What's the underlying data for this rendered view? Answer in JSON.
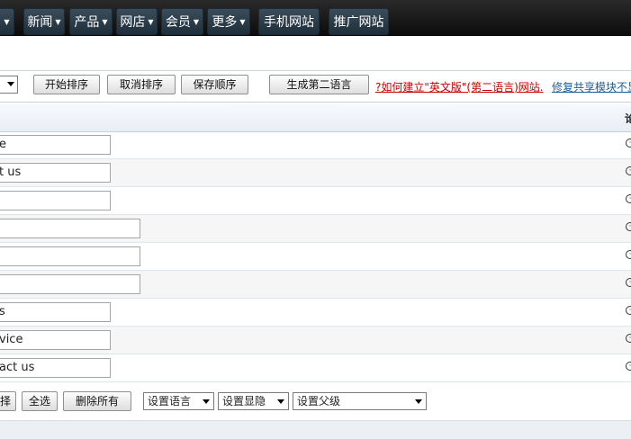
{
  "nav": {
    "items": [
      {
        "label": "新闻",
        "caret": true
      },
      {
        "label": "产品",
        "caret": true
      },
      {
        "label": "网店",
        "caret": true
      },
      {
        "label": "会员",
        "caret": true
      },
      {
        "label": "更多",
        "caret": true
      },
      {
        "label": "手机网站",
        "caret": false
      },
      {
        "label": "推广网站",
        "caret": false
      }
    ],
    "caret_glyph": "▼"
  },
  "toolbar": {
    "start_sort": "开始排序",
    "cancel_sort": "取消排序",
    "save_order": "保存顺序",
    "gen_second_lang": "生成第二语言",
    "help_link": "?如何建立\"英文版\"(第二语言)网站.",
    "repair_link": "修复共享模块不显"
  },
  "table": {
    "header_col": "论",
    "rows": [
      {
        "value": "e"
      },
      {
        "value": "t us"
      },
      {
        "value": ""
      },
      {
        "value": ""
      },
      {
        "value": ""
      },
      {
        "value": ""
      },
      {
        "value": "s"
      },
      {
        "value": "vice"
      },
      {
        "value": "act us"
      }
    ],
    "row_icon": "clock-icon"
  },
  "bottom": {
    "partial_btn": "择",
    "select_all": "全选",
    "delete_all": "删除所有",
    "set_language": "设置语言",
    "set_visibility": "设置显隐",
    "set_parent": "设置父级"
  }
}
